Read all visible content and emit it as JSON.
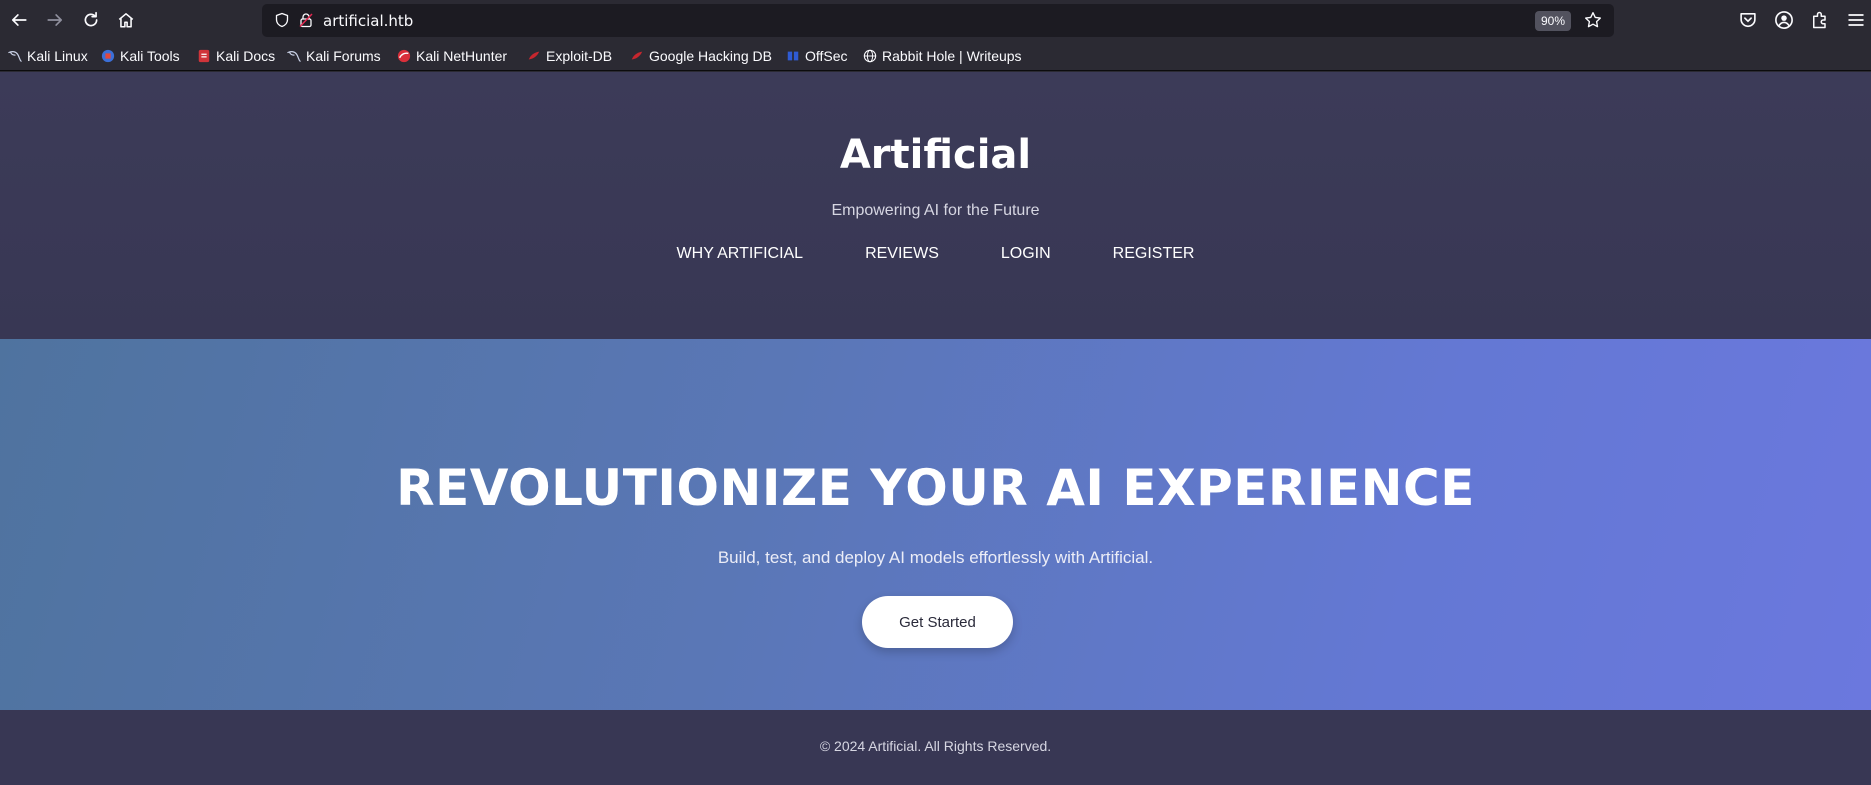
{
  "browser": {
    "url": "artificial.htb",
    "zoom": "90%",
    "bookmarks": [
      {
        "label": "Kali Linux",
        "icon": "kali-dragon-icon"
      },
      {
        "label": "Kali Tools",
        "icon": "kali-tools-icon"
      },
      {
        "label": "Kali Docs",
        "icon": "kali-docs-icon"
      },
      {
        "label": "Kali Forums",
        "icon": "kali-dragon-icon"
      },
      {
        "label": "Kali NetHunter",
        "icon": "nethunter-icon"
      },
      {
        "label": "Exploit-DB",
        "icon": "exploit-db-icon"
      },
      {
        "label": "Google Hacking DB",
        "icon": "ghdb-icon"
      },
      {
        "label": "OffSec",
        "icon": "offsec-icon"
      },
      {
        "label": "Rabbit Hole | Writeups",
        "icon": "globe-icon"
      }
    ]
  },
  "site": {
    "title": "Artificial",
    "tagline": "Empowering AI for the Future",
    "nav": [
      "WHY ARTIFICIAL",
      "REVIEWS",
      "LOGIN",
      "REGISTER"
    ]
  },
  "hero": {
    "title": "REVOLUTIONIZE YOUR AI EXPERIENCE",
    "subtitle": "Build, test, and deploy AI models effortlessly with Artificial.",
    "cta": "Get Started"
  },
  "footer": {
    "text": "© 2024 Artificial. All Rights Reserved."
  },
  "colors": {
    "header_bg": "#3c3b58",
    "hero_start": "#4f739f",
    "hero_end": "#6b78de",
    "footer_bg": "#383754"
  }
}
